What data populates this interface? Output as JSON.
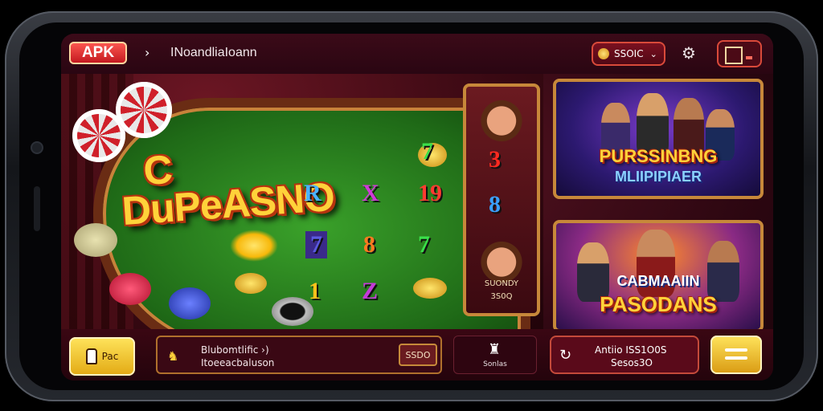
{
  "header": {
    "apk_badge": "APK",
    "back_glyph": "›",
    "app_title": "INoandliaIoann",
    "coin_amount": "SSOIC",
    "dropdown_glyph": "⌄"
  },
  "table": {
    "logo_line1": "DuPeASNO",
    "logo_line0": "C",
    "symbols": [
      "R",
      "X",
      "19",
      "7",
      "8",
      "7",
      "1",
      "Z",
      "7"
    ],
    "side_reel_symbols": [
      "3",
      "8"
    ],
    "side_reel_label1": "SUONDY",
    "side_reel_label2": "3S0Q"
  },
  "cards": [
    {
      "title_line1": "PURSSINBNG",
      "title_line2": "MLIIPIPIAER"
    },
    {
      "title_line1": "CABMAAIIN",
      "title_line2": "PASODANS"
    }
  ],
  "bottom": {
    "yellow_btn_label": "Pac",
    "info_line1": "Blubomtlific ›)",
    "info_line2": "Itoeeacbaluson",
    "info_btn_label": "SSDO",
    "mid_label": "Sonlas",
    "reward_line1": "Antiio ISS1O0S",
    "reward_line2": "Sesos3O"
  },
  "colors": {
    "accent_red": "#d94a3a",
    "gold": "#ffd23a",
    "frame": "#c7883a"
  },
  "icons": [
    "apk-badge",
    "back-arrow-icon",
    "coin-icon",
    "settings-gear-icon",
    "menu-square-icon",
    "key-icon",
    "bell-icon",
    "character-icon",
    "refresh-icon",
    "hamburger-icon"
  ]
}
